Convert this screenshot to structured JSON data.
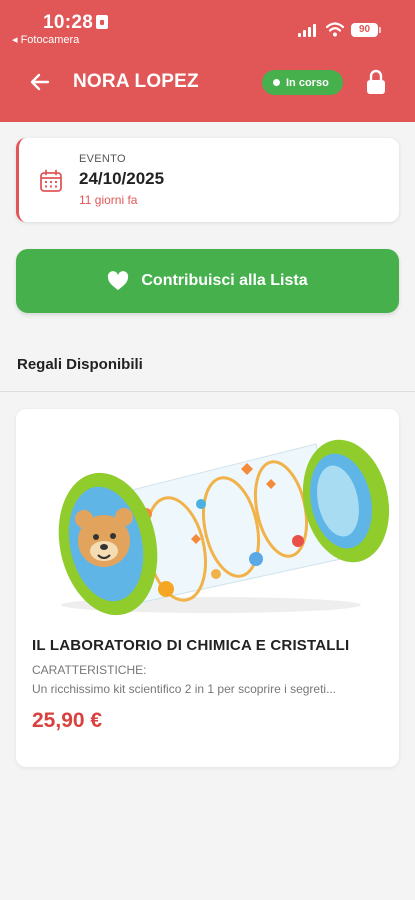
{
  "status_bar": {
    "time": "10:28",
    "back_label": "◂ Fotocamera",
    "battery": "90"
  },
  "header": {
    "title": "NORA LOPEZ",
    "status_badge": "In corso",
    "color": "#e15757"
  },
  "event": {
    "label": "EVENTO",
    "date": "24/10/2025",
    "relative": "11 giorni fa"
  },
  "contribute_button": {
    "label": "Contribuisci alla Lista",
    "color": "#45b04c"
  },
  "gifts": {
    "section_title": "Regali Disponibili",
    "items": [
      {
        "name": "IL LABORATORIO DI CHIMICA E CRISTALLI",
        "features_label": "CARATTERISTICHE:",
        "description": "Un ricchissimo kit scientifico 2 in 1 per scoprire i segreti...",
        "price": "25,90 €"
      }
    ]
  },
  "icons": {
    "back": "arrow-left-icon",
    "lock": "lock-icon",
    "calendar": "calendar-icon",
    "heart": "heart-icon"
  }
}
